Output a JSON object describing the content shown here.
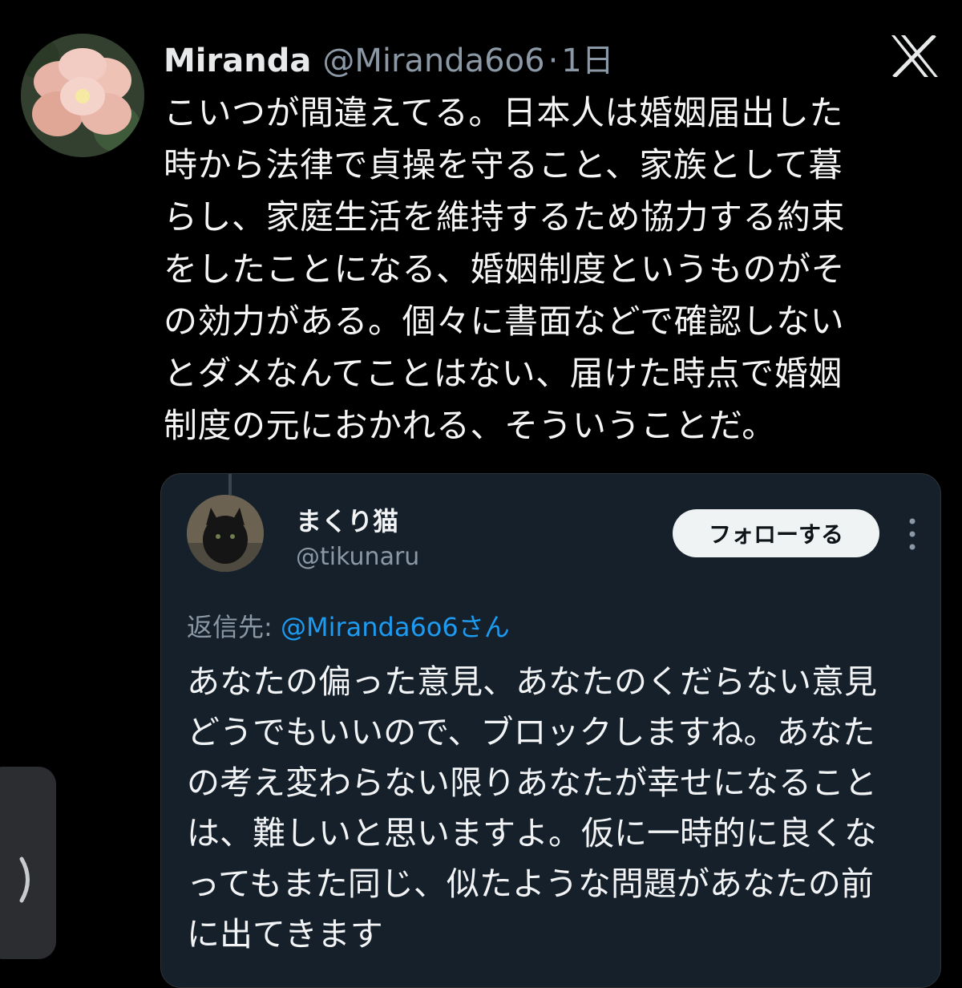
{
  "tweet": {
    "author_name": "Miranda",
    "author_handle": "@Miranda6o6",
    "separator": "·",
    "age": "1日",
    "body": "こいつが間違えてる。日本人は婚姻届出した\n時から法律で貞操を守ること、家族として暮\nらし、家庭生活を維持するため協力する約束\nをしたことになる、婚姻制度というものがそ\nの効力がある。個々に書面などで確認しない\nとダメなんてことはない、届けた時点で婚姻\n制度の元におかれる、そういうことだ。"
  },
  "quoted": {
    "name": "まくり猫",
    "handle": "@tikunaru",
    "follow_label": "フォローする",
    "reply_prefix": "返信先: ",
    "reply_target": "@Miranda6o6さん",
    "body": "あなたの偏った意見、あなたのくだらない意見\nどうでもいいので、ブロックしますね。あなた\nの考え変わらない限りあなたが幸せになること\nは、難しいと思いますよ。仮に一時的に良くな\nってもまた同じ、似たような問題があなたの前\nに出てきます"
  },
  "icons": {
    "brand": "x-logo-icon",
    "more": "more-vertical-icon",
    "side": "chevron-right-icon"
  },
  "colors": {
    "background": "#000000",
    "card": "#15202b",
    "link": "#1d9bf0",
    "muted": "#8b98a5"
  }
}
